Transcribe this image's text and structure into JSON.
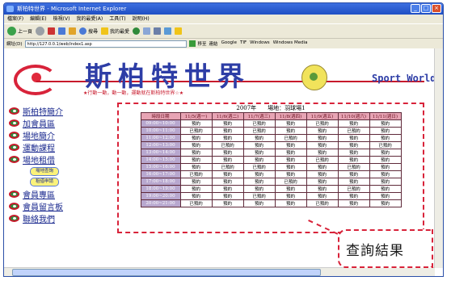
{
  "window": {
    "title": "斯柏特世界 - Microsoft Internet Explorer",
    "controls": [
      "_",
      "□",
      "×"
    ]
  },
  "menu": [
    "檔案(F)",
    "編輯(E)",
    "檢視(V)",
    "我的最愛(A)",
    "工具(T)",
    "說明(H)"
  ],
  "toolbar": {
    "back": "上一頁",
    "search": "搜尋",
    "favorites": "我的最愛"
  },
  "address": {
    "label": "網址(D)",
    "url": "http://127.0.0.1/web/index1.asp",
    "go": "移至",
    "links": [
      "連結",
      "Google",
      "TIF",
      "Windows",
      "Windows Media"
    ]
  },
  "banner": {
    "title": "斯柏特世界",
    "subtitle": "Sport World",
    "slogan": "★行動一動，動一動，運動就在斯柏特世界☆★"
  },
  "sidebar": {
    "items": [
      {
        "label": "斯柏特簡介"
      },
      {
        "label": "加會員區"
      },
      {
        "label": "場地簡介"
      },
      {
        "label": "運動課程"
      },
      {
        "label": "場地租借"
      }
    ],
    "sub_buttons": [
      "場地查詢",
      "租借申請"
    ],
    "items2": [
      {
        "label": "會員專區"
      },
      {
        "label": "會員留言板"
      },
      {
        "label": "聯絡我們"
      }
    ]
  },
  "results": {
    "caption": "2007年　　場地：羽球場1",
    "headers": [
      "時段日期",
      "11/5(週一)",
      "11/6(週二)",
      "11/7(週三)",
      "11/8(週四)",
      "11/9(週五)",
      "11/10(週六)",
      "11/11(週日)"
    ],
    "rows": [
      {
        "time": "09:00~10:00",
        "cells": [
          "預約",
          "預約",
          "已預約",
          "預約",
          "已預約",
          "預約",
          "預約"
        ]
      },
      {
        "time": "10:00~11:00",
        "cells": [
          "已預約",
          "預約",
          "已預約",
          "預約",
          "預約",
          "已預約",
          "預約"
        ]
      },
      {
        "time": "11:00~12:00",
        "cells": [
          "預約",
          "預約",
          "預約",
          "已預約",
          "預約",
          "預約",
          "預約"
        ]
      },
      {
        "time": "12:00~13:00",
        "cells": [
          "預約",
          "已預約",
          "預約",
          "預約",
          "預約",
          "預約",
          "已預約"
        ]
      },
      {
        "time": "13:00~14:00",
        "cells": [
          "預約",
          "預約",
          "預約",
          "預約",
          "預約",
          "預約",
          "預約"
        ]
      },
      {
        "time": "14:00~15:00",
        "cells": [
          "預約",
          "預約",
          "預約",
          "預約",
          "已預約",
          "預約",
          "預約"
        ]
      },
      {
        "time": "15:00~16:00",
        "cells": [
          "預約",
          "已預約",
          "已預約",
          "預約",
          "預約",
          "已預約",
          "預約"
        ]
      },
      {
        "time": "16:00~17:00",
        "cells": [
          "已預約",
          "預約",
          "預約",
          "預約",
          "預約",
          "預約",
          "預約"
        ]
      },
      {
        "time": "17:00~18:00",
        "cells": [
          "預約",
          "預約",
          "預約",
          "已預約",
          "預約",
          "預約",
          "預約"
        ]
      },
      {
        "time": "18:00~19:00",
        "cells": [
          "預約",
          "預約",
          "預約",
          "預約",
          "預約",
          "已預約",
          "預約"
        ]
      },
      {
        "time": "19:00~20:00",
        "cells": [
          "預約",
          "預約",
          "已預約",
          "預約",
          "預約",
          "預約",
          "預約"
        ]
      },
      {
        "time": "20:00~21:00",
        "cells": [
          "已預約",
          "預約",
          "預約",
          "預約",
          "已預約",
          "預約",
          "預約"
        ]
      }
    ]
  },
  "callout": {
    "text": "查詢結果"
  }
}
